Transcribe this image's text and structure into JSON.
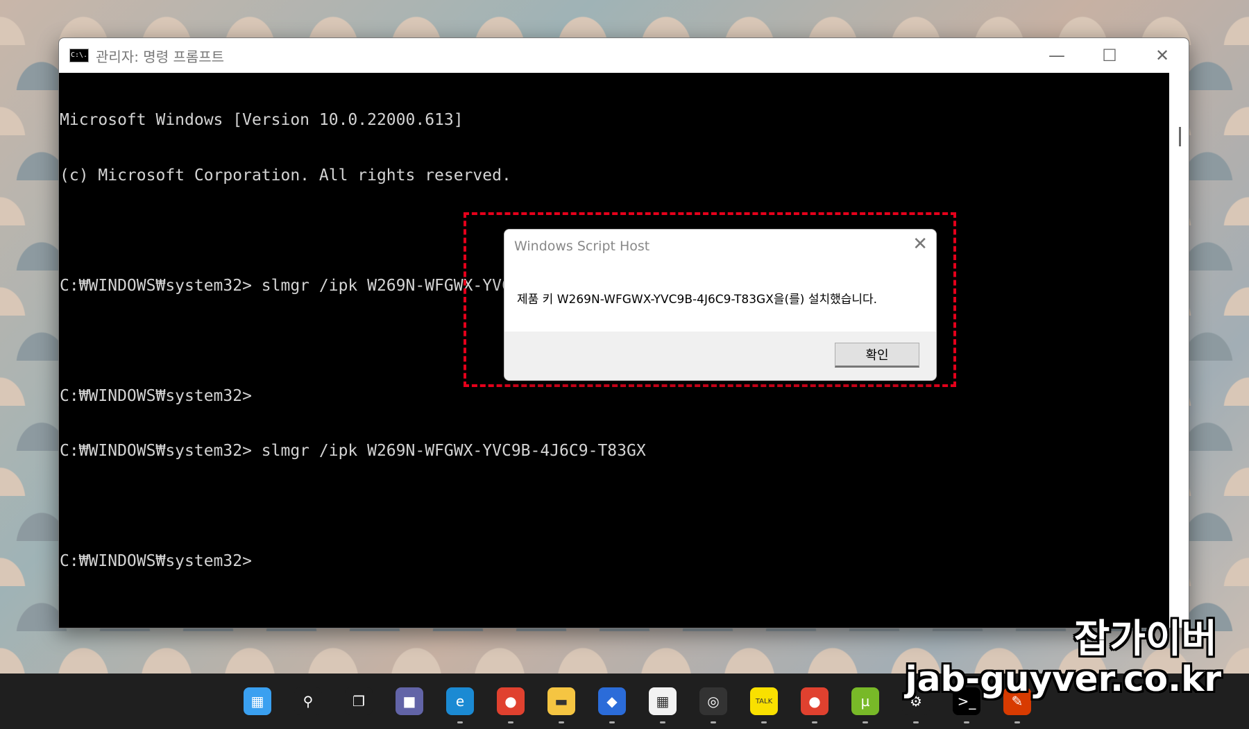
{
  "window": {
    "title": "관리자: 명령 프롬프트",
    "icon_text": "C:\\.",
    "controls": {
      "minimize": "—",
      "maximize": "☐",
      "close": "✕"
    }
  },
  "console": {
    "lines": [
      "Microsoft Windows [Version 10.0.22000.613]",
      "(c) Microsoft Corporation. All rights reserved.",
      "",
      "C:₩WINDOWS₩system32> slmgr /ipk W269N-WFGWX-YVC9B-4J6C9-T83GX",
      "",
      "C:₩WINDOWS₩system32>",
      "C:₩WINDOWS₩system32> slmgr /ipk W269N-WFGWX-YVC9B-4J6C9-T83GX",
      "",
      "C:₩WINDOWS₩system32>"
    ]
  },
  "dialog": {
    "title": "Windows Script Host",
    "close": "✕",
    "message": "제품 키 W269N-WFGWX-YVC9B-4J6C9-T83GX을(를) 설치했습니다.",
    "ok_label": "확인"
  },
  "taskbar": {
    "icons": [
      {
        "name": "start-icon",
        "color": "#3aa0f0",
        "glyph": "▦"
      },
      {
        "name": "search-icon",
        "color": "#1f1f1f",
        "glyph": "⚲"
      },
      {
        "name": "task-view-icon",
        "color": "#1f1f1f",
        "glyph": "❐"
      },
      {
        "name": "teams-chat-icon",
        "color": "#6264a7",
        "glyph": "■"
      },
      {
        "name": "edge-icon",
        "color": "#1b8ad3",
        "glyph": "e"
      },
      {
        "name": "chrome-icon",
        "color": "#e0412f",
        "glyph": "●"
      },
      {
        "name": "file-explorer-icon",
        "color": "#f5c542",
        "glyph": "▬"
      },
      {
        "name": "tool-app-icon",
        "color": "#2b6cd9",
        "glyph": "◆"
      },
      {
        "name": "ms-store-icon",
        "color": "#f2f2f2",
        "glyph": "▦"
      },
      {
        "name": "recording-app-icon",
        "color": "#333333",
        "glyph": "◎"
      },
      {
        "name": "kakaotalk-icon",
        "color": "#f9e000",
        "glyph": "TALK"
      },
      {
        "name": "chrome-profile-icon",
        "color": "#e0412f",
        "glyph": "●"
      },
      {
        "name": "utorrent-icon",
        "color": "#78b928",
        "glyph": "µ"
      },
      {
        "name": "settings-icon",
        "color": "#1f1f1f",
        "glyph": "⚙"
      },
      {
        "name": "terminal-icon",
        "color": "#000000",
        "glyph": ">_"
      },
      {
        "name": "paint-icon",
        "color": "#d83b01",
        "glyph": "✎"
      }
    ]
  },
  "watermark": {
    "name": "잡가이버",
    "url": "jab-guyver.co.kr"
  }
}
